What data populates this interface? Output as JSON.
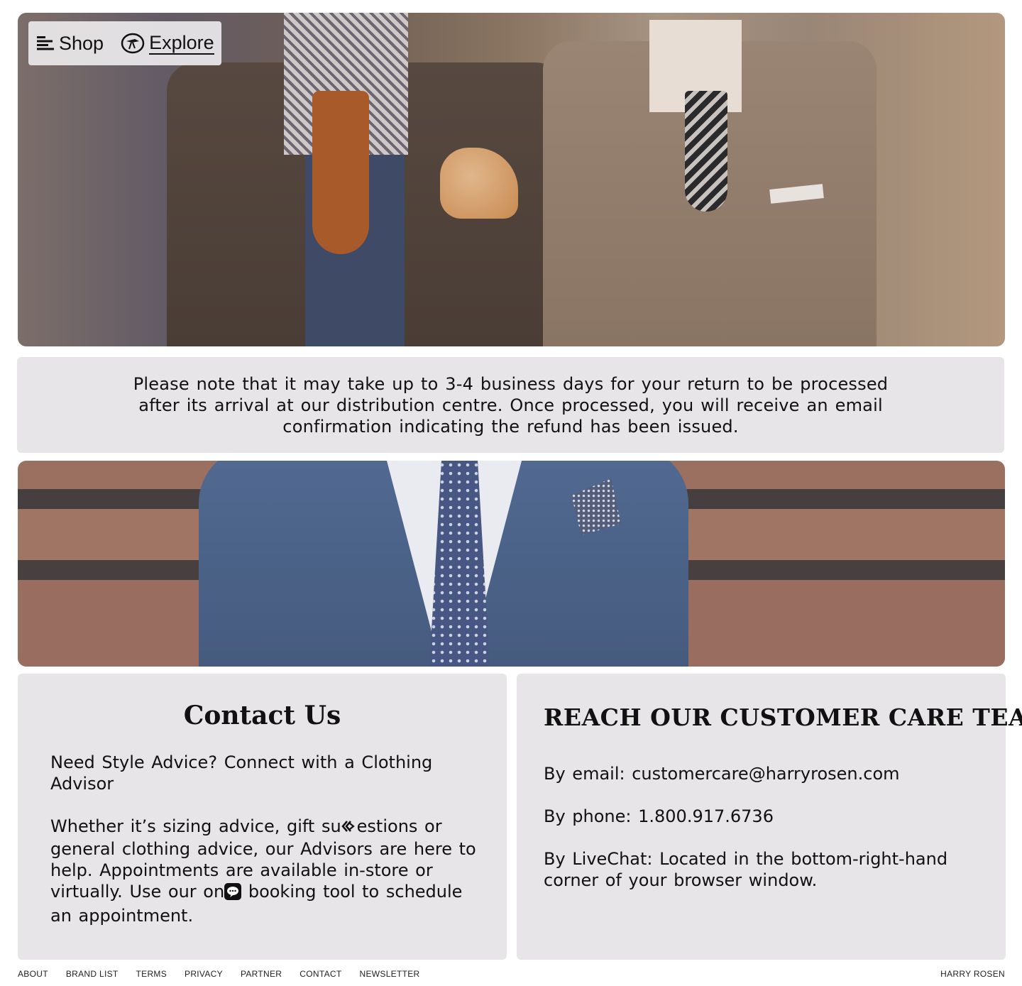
{
  "nav": {
    "shop_label": "Shop",
    "explore_label": "Explore",
    "shop_icon": "menu-lines-icon",
    "explore_icon": "compass-icon"
  },
  "notice": {
    "text": "Please note that it may take up to 3-4 business days for your return to be processed after its arrival at our distribution centre. Once processed, you will receive an email confirmation indicating the refund has been issued."
  },
  "contact": {
    "title": "Contact Us",
    "subtitle": "Need Style Advice? Connect with a Clothing Advisor",
    "body_part1": "Whether it’s sizing advice, gift su",
    "body_part2": "estions or general clothing advice, our Advisors are here to help. Appointments are available in-store or virtually. Use our on",
    "body_part3": " booking tool to schedule an appointment."
  },
  "care": {
    "title": "REACH OUR CUSTOMER CARE TEAM",
    "email_line": "By email: customercare@harryrosen.com",
    "phone_line": "By phone: 1.800.917.6736",
    "chat_line": "By LiveChat: Located in the bottom-right-hand corner of your browser window."
  },
  "footer": {
    "links": [
      "ABOUT",
      "BRAND LIST",
      "TERMS",
      "PRIVACY",
      "PARTNER",
      "CONTACT",
      "NEWSLETTER"
    ],
    "brand": "HARRY ROSEN"
  },
  "colors": {
    "panel_bg": "#e7e5e7",
    "text": "#111111"
  }
}
